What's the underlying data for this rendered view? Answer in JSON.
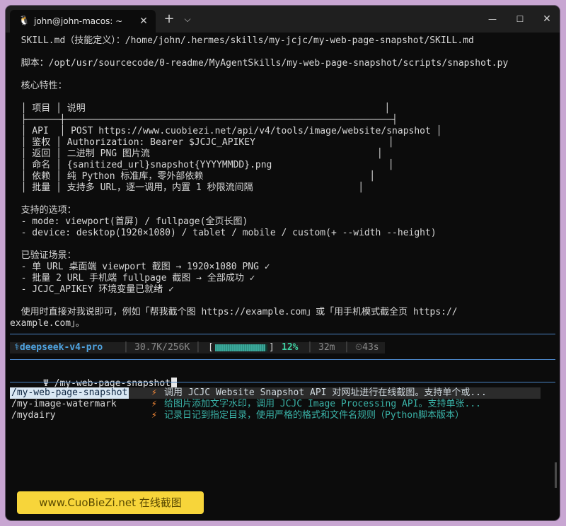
{
  "window": {
    "tab_title": "john@john-macos: ~",
    "tab_icon": "tux-icon",
    "close_label": "✕",
    "newtab_label": "+",
    "dropdown_label": "⌵",
    "min_label": "—",
    "max_label": "☐",
    "winclose_label": "✕"
  },
  "output": [
    "  SKILL.md（技能定义）：/home/john/.hermes/skills/my-jcjc/my-web-page-snapshot/SKILL.md",
    "",
    "  脚本：/opt/usr/sourcecode/0-readme/MyAgentSkills/my-web-page-snapshot/scripts/snapshot.py",
    "",
    "  核心特性：",
    "",
    "  │ 项目 │ 说明                                                      │",
    "  ├──────┼───────────────────────────────────────────────────────────┤",
    "  │ API  │ POST https://www.cuobiezi.net/api/v4/tools/image/website/snapshot │",
    "  │ 鉴权 │ Authorization: Bearer $JCJC_APIKEY                        │",
    "  │ 返回 │ 二进制 PNG 图片流                                         │",
    "  │ 命名 │ {sanitized_url}snapshot{YYYYMMDD}.png                     │",
    "  │ 依赖 │ 纯 Python 标准库，零外部依赖                              │",
    "  │ 批量 │ 支持多 URL，逐一调用，内置 1 秒限流间隔                   │",
    "",
    "  支持的选项：",
    "  - mode: viewport(首屏) / fullpage(全页长图)",
    "  - device: desktop(1920×1080) / tablet / mobile / custom(+ --width --height)",
    "",
    "  已验证场景：",
    "  - 单 URL 桌面端 viewport 截图 → 1920×1080 PNG ✓",
    "  - 批量 2 URL 手机端 fullpage 截图 → 全部成功 ✓",
    "  - JCJC_APIKEY 环境变量已就绪 ✓",
    "",
    "  使用时直接对我说即可，例如「帮我截个图 https://example.com」或「用手机模式截全页 https://",
    "example.com」。"
  ],
  "status": {
    "model": "⚕deepseek-v4-pro",
    "tokens": "30.7K/256K",
    "progress_open": "[",
    "progress_close": "]",
    "progress": 0.12,
    "percent": "12%",
    "duration": "32m",
    "timer": "⏲43s",
    "sep": "│"
  },
  "prompt": {
    "symbol": "Ψ",
    "input": "/my-web-page-snapshot"
  },
  "completions": [
    {
      "command": "/my-web-page-snapshot",
      "icon": "⚡",
      "description": "调用 JCJC Website Snapshot API 对网址进行在线截图。支持单个或...",
      "selected": true
    },
    {
      "command": "/my-image-watermark",
      "icon": "⚡",
      "description": "给图片添加文字水印，调用 JCJC Image Processing API。支持单张...",
      "selected": false
    },
    {
      "command": "/mydairy",
      "icon": "⚡",
      "description": "记录日记到指定目录，使用严格的格式和文件名规则（Python脚本版本）",
      "selected": false
    }
  ],
  "watermark": "www.CuoBieZi.net 在线截图",
  "colors": {
    "accent": "#4a84c4",
    "status_green": "#3fd1a3",
    "completion_desc": "#3ab3a8",
    "bolt": "#ff8f3a"
  }
}
